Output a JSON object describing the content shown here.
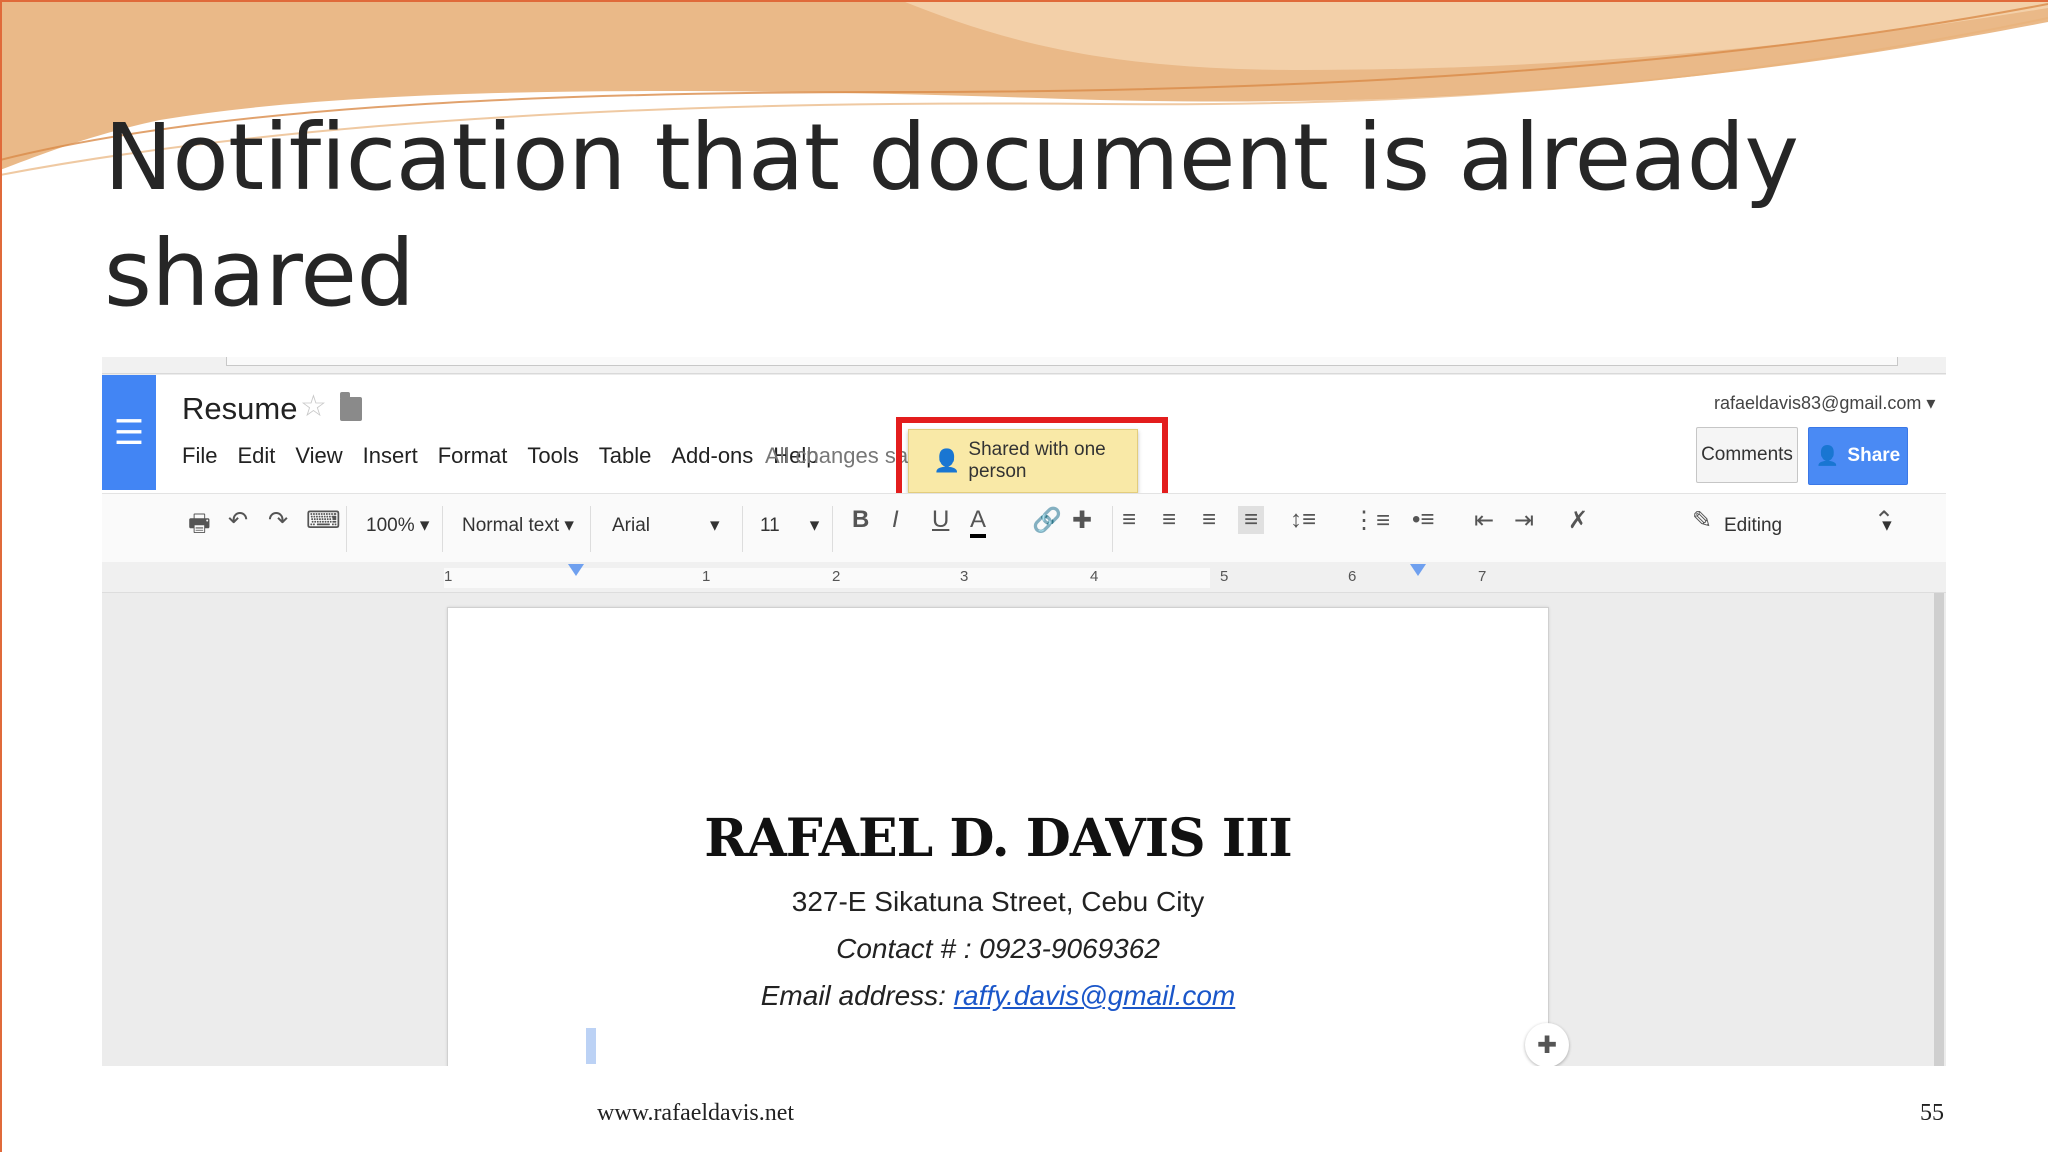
{
  "slide": {
    "title": "Notification that document is already shared",
    "footer_url": "www.rafaeldavis.net",
    "page_number": "55"
  },
  "docs": {
    "doc_title": "Resume",
    "menu": [
      "File",
      "Edit",
      "View",
      "Insert",
      "Format",
      "Tools",
      "Table",
      "Add-ons",
      "Help"
    ],
    "save_status": "All changes saved",
    "notification": "Shared with one person",
    "account_email": "rafaeldavis83@gmail.com",
    "comments_label": "Comments",
    "share_label": "Share",
    "toolbar": {
      "zoom": "100%",
      "style": "Normal text",
      "font": "Arial",
      "font_size": "11",
      "mode": "Editing"
    },
    "ruler_numbers": [
      "1",
      "1",
      "2",
      "3",
      "4",
      "5",
      "6",
      "7"
    ]
  },
  "resume": {
    "name": "RAFAEL D. DAVIS III",
    "address": "327-E Sikatuna Street, Cebu City",
    "contact": "Contact # : 0923-9069362",
    "email_label": "Email address: ",
    "email": "raffy.davis@gmail.com"
  },
  "colors": {
    "docs_blue": "#4285f4",
    "share_blue": "#4a8af4",
    "highlight_red": "#e31d1d",
    "toast_yellow": "#f9e9a7",
    "slide_accent": "#e8a25f"
  }
}
